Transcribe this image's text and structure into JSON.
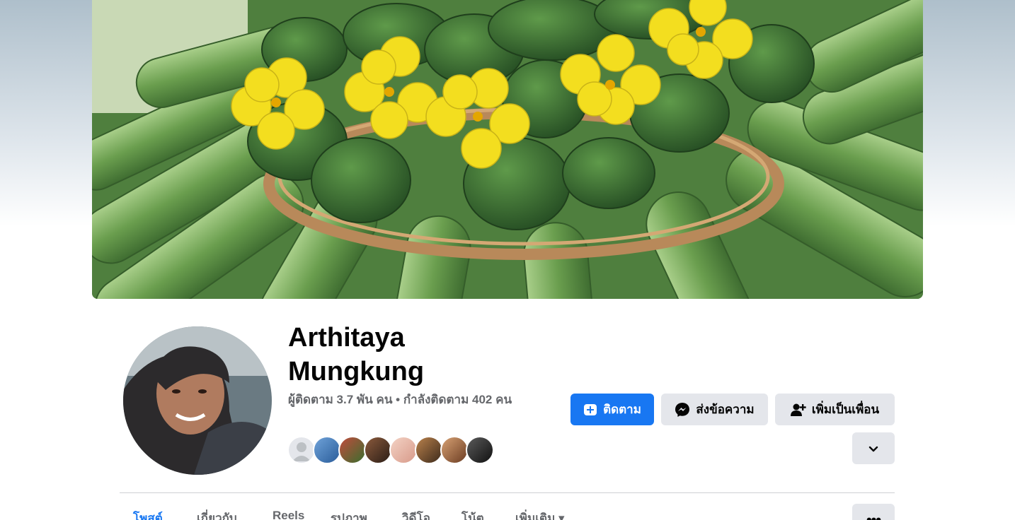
{
  "profile": {
    "name": "Arthitaya Mungkung",
    "stats": "ผู้ติดตาม 3.7 พัน คน • กำลังติดตาม 402 คน"
  },
  "actions": {
    "follow_label": "ติดตาม",
    "message_label": "ส่งข้อความ",
    "add_friend_label": "เพิ่มเป็นเพื่อน"
  },
  "tabs": [
    {
      "label": "โพสต์",
      "active": true
    },
    {
      "label": "เกี่ยวกับ"
    },
    {
      "label": "Reels"
    },
    {
      "label": "รูปภาพ"
    },
    {
      "label": "วิดีโอ"
    },
    {
      "label": "โน้ต"
    },
    {
      "label": "เพิ่มเติม ▾"
    }
  ],
  "more_button_label": "•••",
  "colors": {
    "primary": "#1877f2",
    "secondary_bg": "#e4e6eb",
    "muted_text": "#65676b"
  }
}
